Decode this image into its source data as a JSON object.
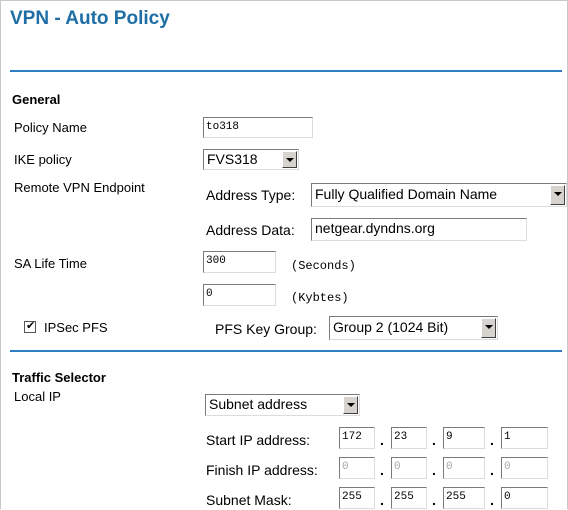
{
  "page": {
    "title": "VPN - Auto Policy"
  },
  "general": {
    "heading": "General",
    "policy_name_label": "Policy Name",
    "policy_name_value": "to318",
    "ike_policy_label": "IKE policy",
    "ike_policy_value": "FVS318",
    "remote_endpoint_label": "Remote VPN Endpoint",
    "address_type_label": "Address Type:",
    "address_type_value": "Fully Qualified Domain Name",
    "address_data_label": "Address Data:",
    "address_data_value": "netgear.dyndns.org",
    "sa_life_label": "SA Life Time",
    "sa_seconds_value": "300",
    "sa_seconds_unit": "(Seconds)",
    "sa_kbytes_value": "0",
    "sa_kbytes_unit": "(Kybtes)",
    "ipsec_pfs_label": "IPSec PFS",
    "ipsec_pfs_checked": true,
    "pfs_key_group_label": "PFS Key Group:",
    "pfs_key_group_value": "Group 2 (1024 Bit)"
  },
  "traffic": {
    "heading": "Traffic Selector",
    "local_ip_label": "Local IP",
    "local_ip_type": "Subnet address",
    "start_ip_label": "Start IP address:",
    "start_ip": [
      "172",
      "23",
      "9",
      "1"
    ],
    "finish_ip_label": "Finish IP address:",
    "finish_ip": [
      "0",
      "0",
      "0",
      "0"
    ],
    "subnet_mask_label": "Subnet Mask:",
    "subnet_mask": [
      "255",
      "255",
      "255",
      "0"
    ]
  }
}
